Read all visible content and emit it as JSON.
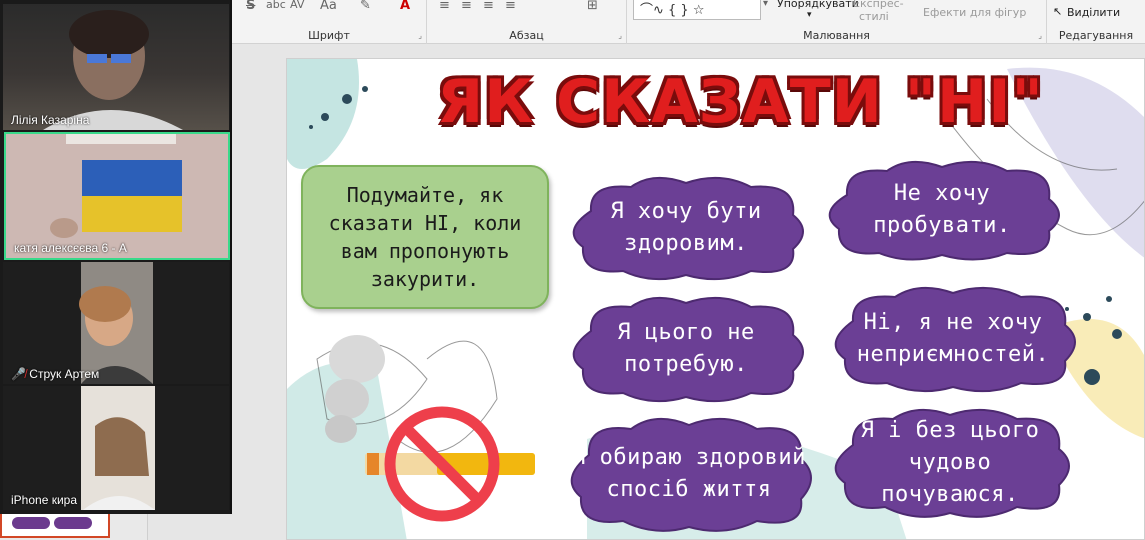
{
  "ribbon": {
    "font_group": "Шрифт",
    "paragraph_group": "Абзац",
    "drawing_group": "Малювання",
    "editing_group": "Редагування",
    "arrange_label": "Упорядкувати",
    "express_label": "Експрес-",
    "styles_label": "стилі",
    "effects_label": "Ефекти для фігур",
    "select_label": "Виділити",
    "strike_icon": "S",
    "abc_label": "abc",
    "av_label": "AV",
    "aa_label": "Aa",
    "fontcolor_label": "A"
  },
  "participants": [
    {
      "name": "Лілія Казаріна",
      "muted": false
    },
    {
      "name": "катя алексєєва 6 - А",
      "muted": false
    },
    {
      "name": "Струк Артем",
      "muted": true
    },
    {
      "name": "iPhone кира",
      "muted": false
    }
  ],
  "slide": {
    "title": "ЯК СКАЗАТИ \"НІ\"",
    "prompt": "Подумайте, як сказати НІ, коли вам пропонують закурити.",
    "phrases": [
      "Я хочу бути здоровим.",
      "Не хочу пробувати.",
      "Я цього не потребую.",
      "Ні, я не хочу неприємностей.",
      "Я обираю здоровий спосіб життя",
      "Я і без цього чудово почуваюся."
    ]
  },
  "colors": {
    "cloud": "#6b3f95",
    "cloud_edge": "#4d2a70",
    "title_red": "#e01e1e",
    "prompt_green": "#a9d08e",
    "active_border": "#39d98a"
  }
}
